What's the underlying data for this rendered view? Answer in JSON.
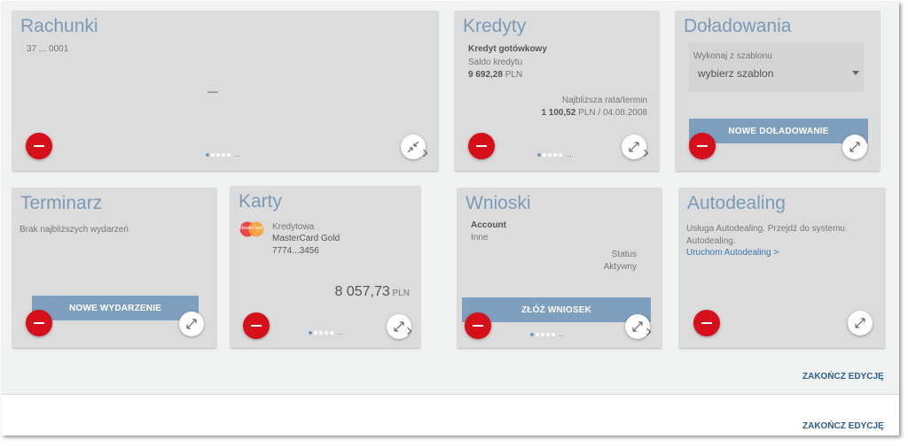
{
  "rachunki": {
    "title": "Rachunki",
    "account_number": "37 ... 0001",
    "balance_placeholder": "—",
    "pager_ellipsis": "..."
  },
  "kredyty": {
    "title": "Kredyty",
    "name": "Kredyt gotówkowy",
    "saldo_label": "Saldo kredytu",
    "saldo_value": "9 692,28",
    "saldo_currency": "PLN",
    "next_rate_label": "Najbliższa rata/termin",
    "next_rate_value": "1 100,52",
    "next_rate_rest": "PLN / 04.08.2008",
    "pager_ellipsis": "..."
  },
  "doladowania": {
    "title": "Doładowania",
    "template_label": "Wykonaj z szablonu",
    "template_value": "wybierz szablon",
    "button_label": "NOWE DOŁADOWANIE"
  },
  "terminarz": {
    "title": "Terminarz",
    "empty_text": "Brak najbliższych wydarzeń",
    "button_label": "NOWE WYDARZENIE"
  },
  "karty": {
    "title": "Karty",
    "card_type": "Kredytowa",
    "card_name": "MasterCard Gold",
    "card_number": "7774...3456",
    "balance": "8 057,73",
    "currency": "PLN",
    "logo_text": "MasterCard",
    "pager_ellipsis": "..."
  },
  "wnioski": {
    "title": "Wnioski",
    "item_name": "Account",
    "item_sub": "Inne",
    "status_label": "Status",
    "status_value": "Aktywny",
    "button_label": "ZŁÓŻ WNIOSEK",
    "pager_ellipsis": "..."
  },
  "autodealing": {
    "title": "Autodealing",
    "description_line1": "Usługa Autodealing. Przejdź do systemu",
    "description_line2": "Autodealing.",
    "link_label": "Uruchom Autodealing >"
  },
  "footer": {
    "finish_edit_top": "ZAKOŃCZ EDYCJĘ",
    "finish_edit_bottom": "ZAKOŃCZ EDYCJĘ"
  },
  "colors": {
    "accent": "#7a9ab7",
    "remove": "#d6101b",
    "button": "#7f9fbf",
    "link": "#3f78ad",
    "card_bg": "#dcdcdc"
  },
  "icons": {
    "remove": "minus-circle-icon",
    "expand": "expand-arrows-icon",
    "collapse": "collapse-arrows-icon",
    "dropdown": "caret-down-icon",
    "next": "chevron-right-icon"
  }
}
